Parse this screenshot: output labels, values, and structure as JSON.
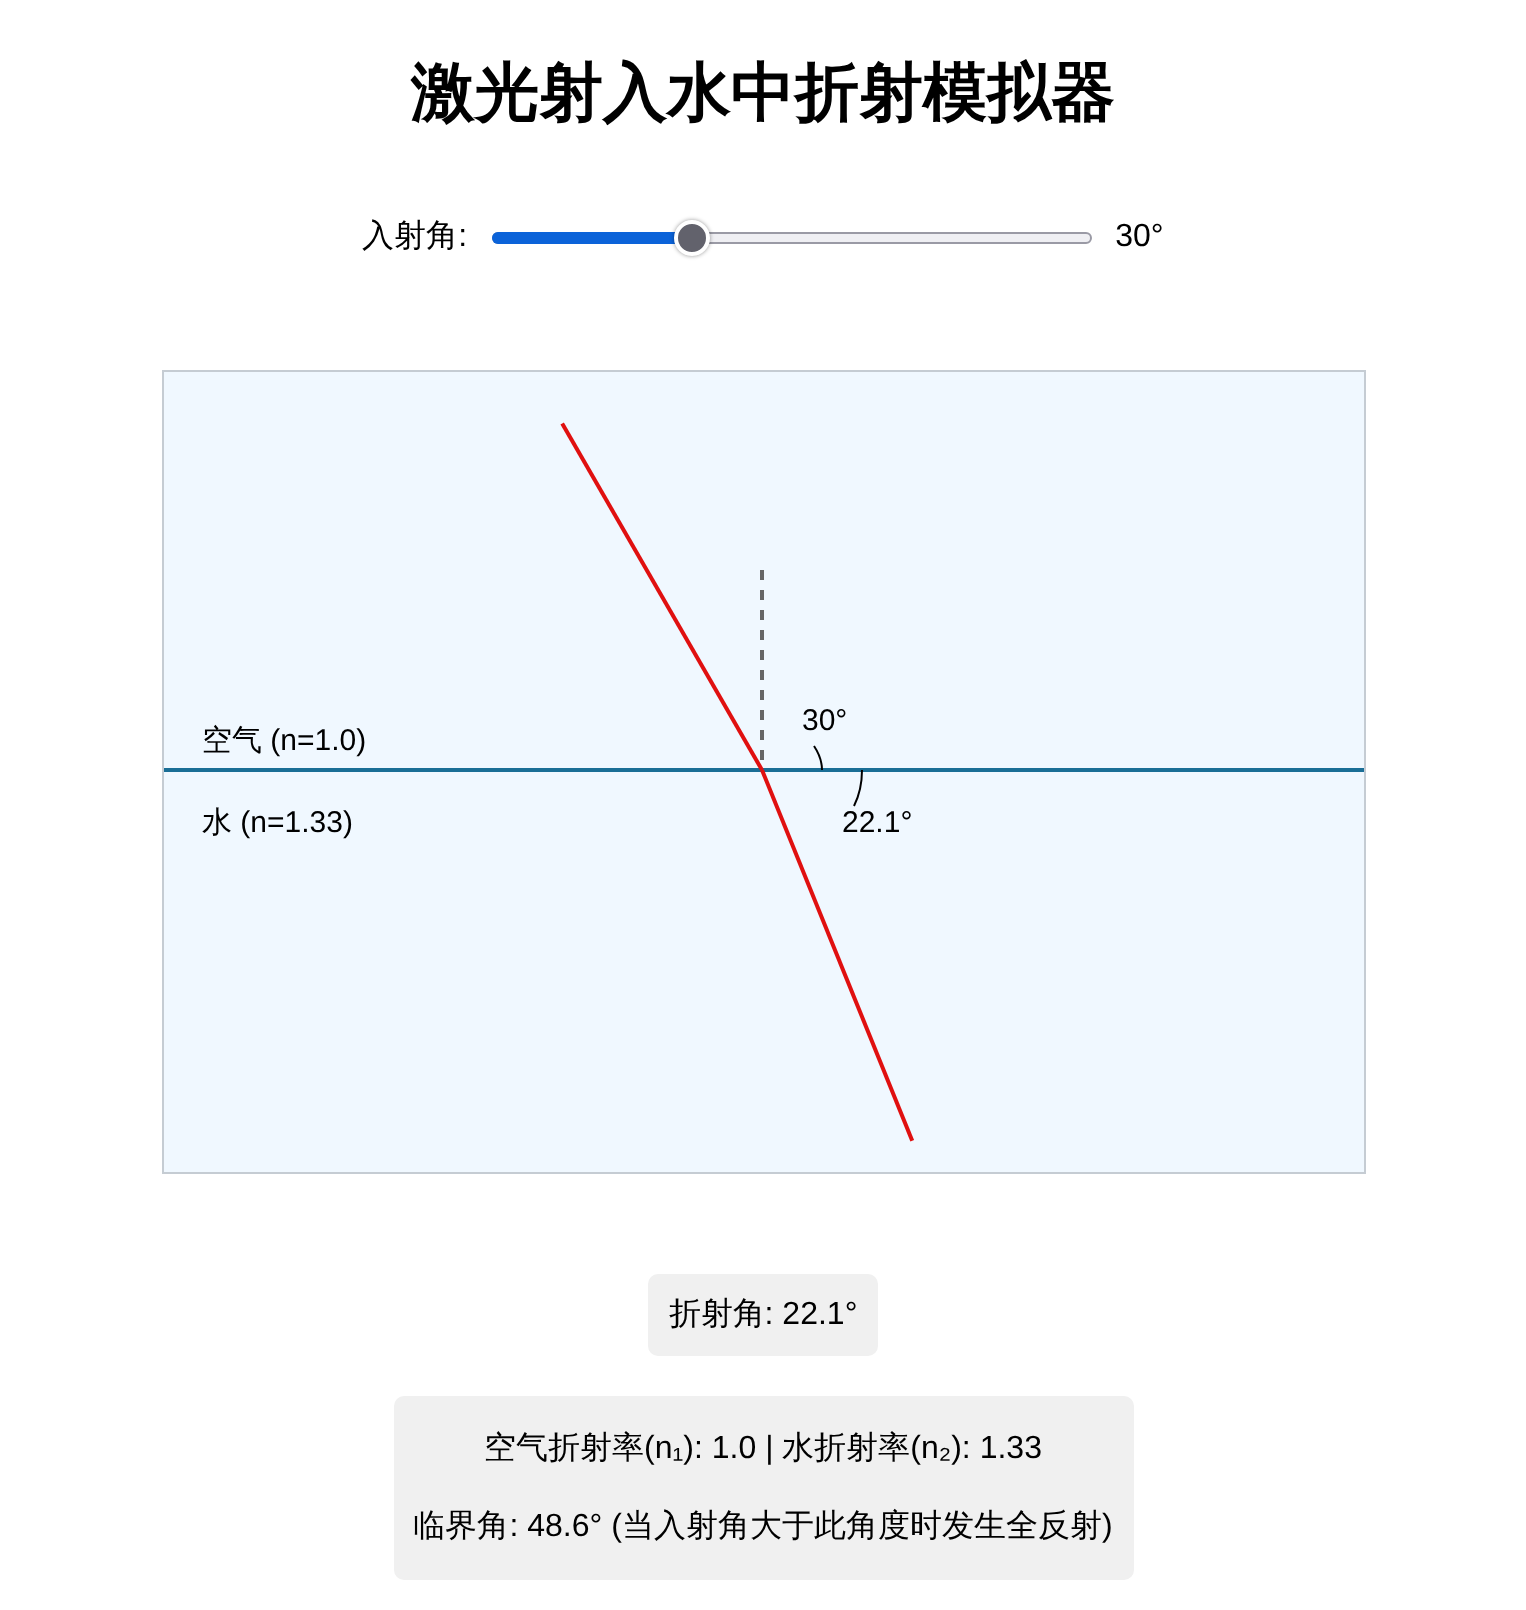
{
  "title": "激光射入水中折射模拟器",
  "slider": {
    "label": "入射角:",
    "level": 0.333,
    "reading": "30°"
  },
  "diagram": {
    "air_label": "空气 (n=1.0)",
    "water_label": "水 (n=1.33)",
    "incident_angle_label": "30°",
    "refracted_angle_label": "22.1°"
  },
  "result": "折射角: 22.1°",
  "info": [
    "空气折射率(n₁): 1.0 | 水折射率(n₂): 1.33",
    "临界角: 48.6° (当入射角大于此角度时发生全反射)"
  ]
}
